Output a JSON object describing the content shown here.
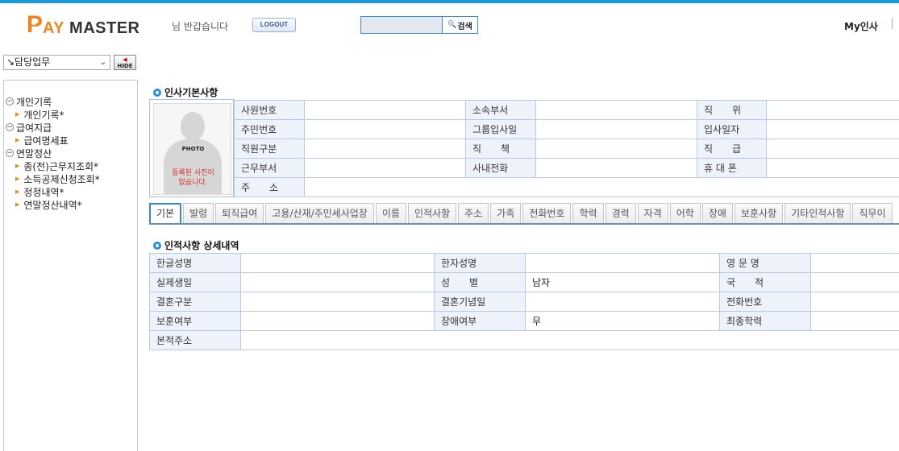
{
  "header": {
    "logo_p": "P",
    "logo_ay": "AY",
    "logo_master": "MASTER",
    "welcome": "님 반갑습니다",
    "logout": "LOGOUT",
    "search_placeholder": "",
    "search_button": "검색",
    "my_insa": "My인사"
  },
  "sidebar": {
    "task_select": "↘담당업무",
    "hide": "HIDE",
    "tree": [
      {
        "label": "개인기록",
        "items": [
          "개인기록*"
        ]
      },
      {
        "label": "급여지급",
        "items": [
          "급여명세표"
        ]
      },
      {
        "label": "연말정산",
        "items": [
          "종(전)근무지조회*",
          "소득공제신청조회*",
          "정정내역*",
          "연말정산내역*"
        ]
      }
    ]
  },
  "basic": {
    "title": "인사기본사항",
    "photo_label": "PHOTO",
    "photo_msg_1": "등록된 사진이",
    "photo_msg_2": "없습니다.",
    "labels": {
      "emp_no": "사원번호",
      "resident_no": "주민번호",
      "emp_type": "직원구분",
      "work_dept": "근무부서",
      "address": "주　　소",
      "dept": "소속부서",
      "group_join": "그룹입사일",
      "duty": "직　　책",
      "phone": "사내전화",
      "position": "직　　위",
      "join_date": "입사일자",
      "grade": "직　　급",
      "mobile": "휴 대 폰"
    }
  },
  "tabs": [
    "기본",
    "발령",
    "퇴직급여",
    "고용/산재/주민세사업장",
    "이름",
    "인적사항",
    "주소",
    "가족",
    "전화번호",
    "학력",
    "경력",
    "자격",
    "어학",
    "장애",
    "보훈사항",
    "기타인적사항",
    "직무이"
  ],
  "detail": {
    "title": "인적사항 상세내역",
    "labels": {
      "korean_name": "한글성명",
      "birth": "실제생일",
      "marital": "결혼구분",
      "veteran": "보훈여부",
      "domicile": "본적주소",
      "hanja_name": "한자성명",
      "gender": "성　　별",
      "wedding_day": "결혼기념일",
      "disability": "장애여부",
      "english_name": "영 문 명",
      "nationality": "국　　적",
      "phone_no": "전화번호",
      "education": "최종학력"
    },
    "values": {
      "gender": "남자",
      "disability": "무"
    }
  }
}
